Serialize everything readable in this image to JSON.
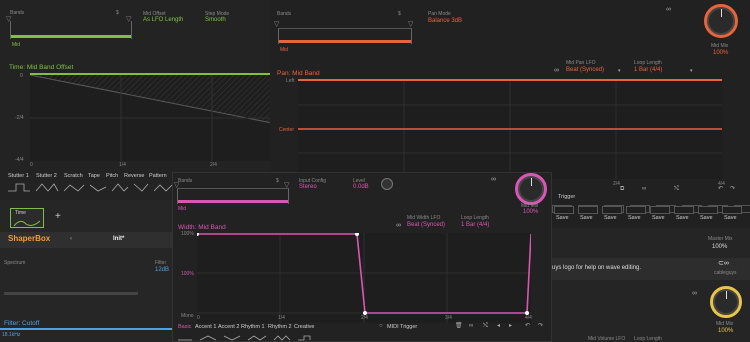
{
  "panel_green": {
    "bands_label": "Bands",
    "dollar": "$",
    "band_name": "Mid",
    "mid_offset_label": "Mid  Offset",
    "mid_offset_value": "As LFO Length",
    "step_mode_label": "Step Mode",
    "step_mode_value": "Smooth",
    "title": "Time: Mid Band Offset",
    "y_ticks": [
      "0",
      "-2/4",
      "-4/4"
    ],
    "x_ticks": [
      "0",
      "1/4",
      "2/4"
    ],
    "tabs": [
      "Stutter 1",
      "Stutter 2",
      "Scratch",
      "Tape",
      "Pitch",
      "Reverse",
      "Pattern"
    ],
    "color": "#7fc241"
  },
  "panel_orange": {
    "bands_label": "Bands",
    "dollar": "$",
    "band_name": "Mid",
    "pan_mode_label": "Pan Mode",
    "pan_mode_value": "Balance 3dB",
    "mid_mix_label": "Mid Mix",
    "mid_mix_value": "100%",
    "title": "Pan: Mid Band",
    "lfo_label": "Mid Pan LFO",
    "lfo_value": "Beat (Synced)",
    "loop_label": "Loop Length",
    "loop_value": "1 Bar (4/4)",
    "y_ticks": [
      "Left",
      "Center"
    ],
    "x_ticks": [
      "2/4",
      "4/4"
    ],
    "trigger_label": "Trigger",
    "save_labels": [
      "Save",
      "Save",
      "Save",
      "Save",
      "Save",
      "Save",
      "Save",
      "Save"
    ],
    "color": "#e8643a"
  },
  "shaperbox": {
    "time_button": "Time",
    "add": "+",
    "logo": "ShaperBox",
    "preset": "Init*",
    "spectrum_label": "Spectrum",
    "filter_label": "Filter",
    "filter_value": "12dB",
    "filter_title": "Filter: Cutoff",
    "filter_value2": "18.1kHz"
  },
  "panel_right": {
    "master_mix_label": "Master Mix",
    "master_mix_value": "100%",
    "help_text": "uys logo for help on wave editing.",
    "brand": "cableguys",
    "mid_mix_label": "Mid Mix",
    "mid_mix_value": "100%",
    "volume_lfo_label": "Mid Volume LFO",
    "loop_label": "Loop Length"
  },
  "panel_pink": {
    "bands_label": "Bands",
    "dollar": "$",
    "band_name": "Mid",
    "input_config_label": "Input Config",
    "input_config_value": "Stereo",
    "level_label": "Level",
    "level_value": "0.0dB",
    "mid_mix_label": "Mid Mix",
    "mid_mix_value": "100%",
    "title": "Width: Mid Band",
    "lfo_label": "Mid Width LFO",
    "lfo_value": "Beat (Synced)",
    "loop_label": "Loop Length",
    "loop_value": "1 Bar (4/4)",
    "y_ticks": [
      "100%",
      "100%",
      "Mono"
    ],
    "x_ticks": [
      "0",
      "1/4",
      "2/4",
      "3/4",
      "4/4"
    ],
    "tabs": [
      "Basic",
      "Accent 1",
      "Accent 2",
      "Rhythm 1",
      "Rhythm 2",
      "Creative"
    ],
    "midi_trigger": "MIDI Trigger",
    "color": "#d957b3"
  }
}
